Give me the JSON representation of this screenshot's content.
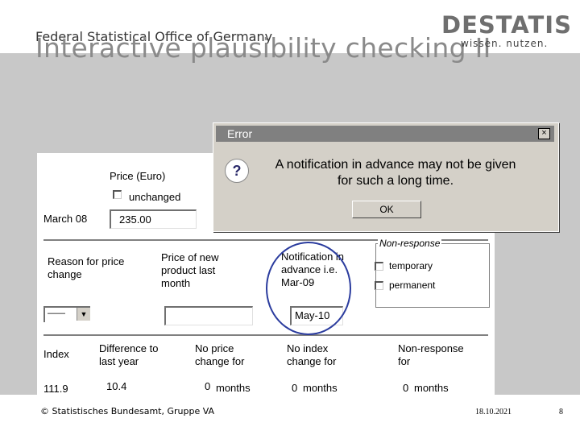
{
  "slide": {
    "agency": "Federal Statistical Office of Germany",
    "title": "Interactive plausibility checking II",
    "logo_brand": "DESTATIS",
    "logo_tagline": "wissen. nutzen.",
    "footer_left": "© Statistisches Bundesamt, Gruppe VA",
    "footer_date": "18.10.2021",
    "footer_page": "8"
  },
  "form": {
    "price_label": "Price (Euro)",
    "unchanged_label": "unchanged",
    "period_label": "March 08",
    "price_value": "235.00",
    "reason_label": "Reason for price change",
    "new_price_label": "Price of new product last month",
    "notification_label": "Notification in advance i.e. Mar-09",
    "notification_value": "May-10",
    "nonresponse_group_label": "Non-response",
    "temporary_label": "temporary",
    "permanent_label": "permanent",
    "reason_select_value": "——",
    "index_label": "Index",
    "diff_label": "Difference to last year",
    "no_price_change_label": "No price change for",
    "no_index_change_label": "No index change for",
    "nonresponse_for_label": "Non-response for",
    "index_value": "111.9",
    "diff_value": "10.4",
    "no_price_months_value": "0",
    "no_index_months_value": "0",
    "nonresponse_months_value": "0",
    "months_label": "months"
  },
  "dialog": {
    "title": "Error",
    "close_glyph": "×",
    "icon_glyph": "?",
    "message": "A notification in advance may not be given for such a long time.",
    "ok_label": "OK"
  }
}
